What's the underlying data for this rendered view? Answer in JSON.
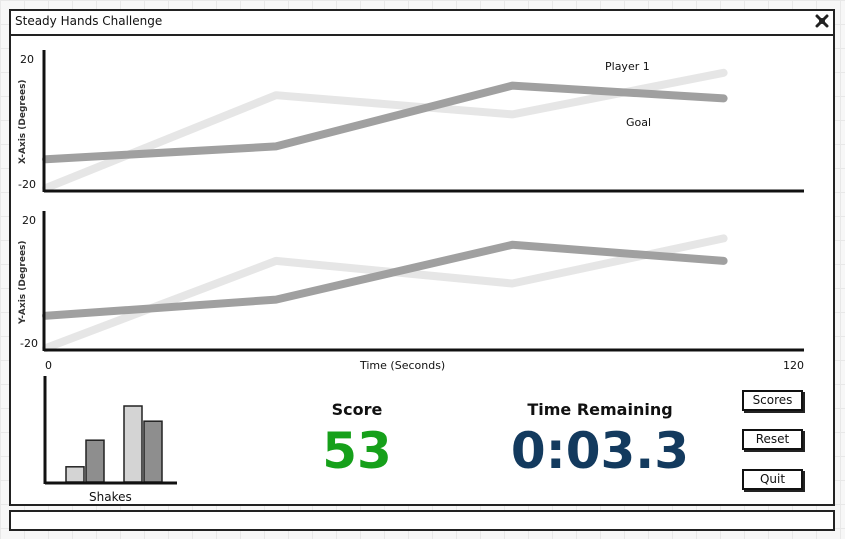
{
  "window": {
    "title": "Steady Hands Challenge"
  },
  "chart_data": [
    {
      "type": "line",
      "ylabel": "X-Axis (Degrees)",
      "ylim": [
        -20,
        20
      ],
      "xlim": [
        0,
        120
      ],
      "yticks": [
        "20",
        "-20"
      ],
      "series": [
        {
          "name": "Player 1",
          "color": "#a0a0a0",
          "points": [
            [
              0,
              -11
            ],
            [
              37,
              -7
            ],
            [
              75,
              12
            ],
            [
              109,
              8
            ]
          ]
        },
        {
          "name": "Goal",
          "color": "#e6e6e6",
          "points": [
            [
              0,
              -20
            ],
            [
              37,
              9
            ],
            [
              75,
              3
            ],
            [
              109,
              16
            ]
          ]
        }
      ],
      "annotations": [
        "Player 1",
        "Goal"
      ]
    },
    {
      "type": "line",
      "ylabel": "Y-Axis (Degrees)",
      "ylim": [
        -20,
        20
      ],
      "xlim": [
        0,
        120
      ],
      "yticks": [
        "20",
        "-20"
      ],
      "xticks": [
        "0",
        "120"
      ],
      "xlabel": "Time (Seconds)",
      "series": [
        {
          "color": "#a0a0a0",
          "points": [
            [
              0,
              -10
            ],
            [
              37,
              -5
            ],
            [
              75,
              12
            ],
            [
              109,
              7
            ]
          ]
        },
        {
          "color": "#e6e6e6",
          "points": [
            [
              0,
              -20
            ],
            [
              37,
              7
            ],
            [
              75,
              0
            ],
            [
              109,
              14
            ]
          ]
        }
      ]
    },
    {
      "type": "bar",
      "xlabel": "Shakes",
      "series": [
        {
          "color": "#d4d4d4",
          "values": [
            2,
            10
          ]
        },
        {
          "color": "#8e8e8e",
          "values": [
            5.5,
            8
          ]
        }
      ]
    }
  ],
  "score": {
    "label": "Score",
    "value": "53"
  },
  "timer": {
    "label": "Time Remaining",
    "value": "0:03.3"
  },
  "buttons": {
    "scores": "Scores",
    "reset": "Reset",
    "quit": "Quit"
  }
}
